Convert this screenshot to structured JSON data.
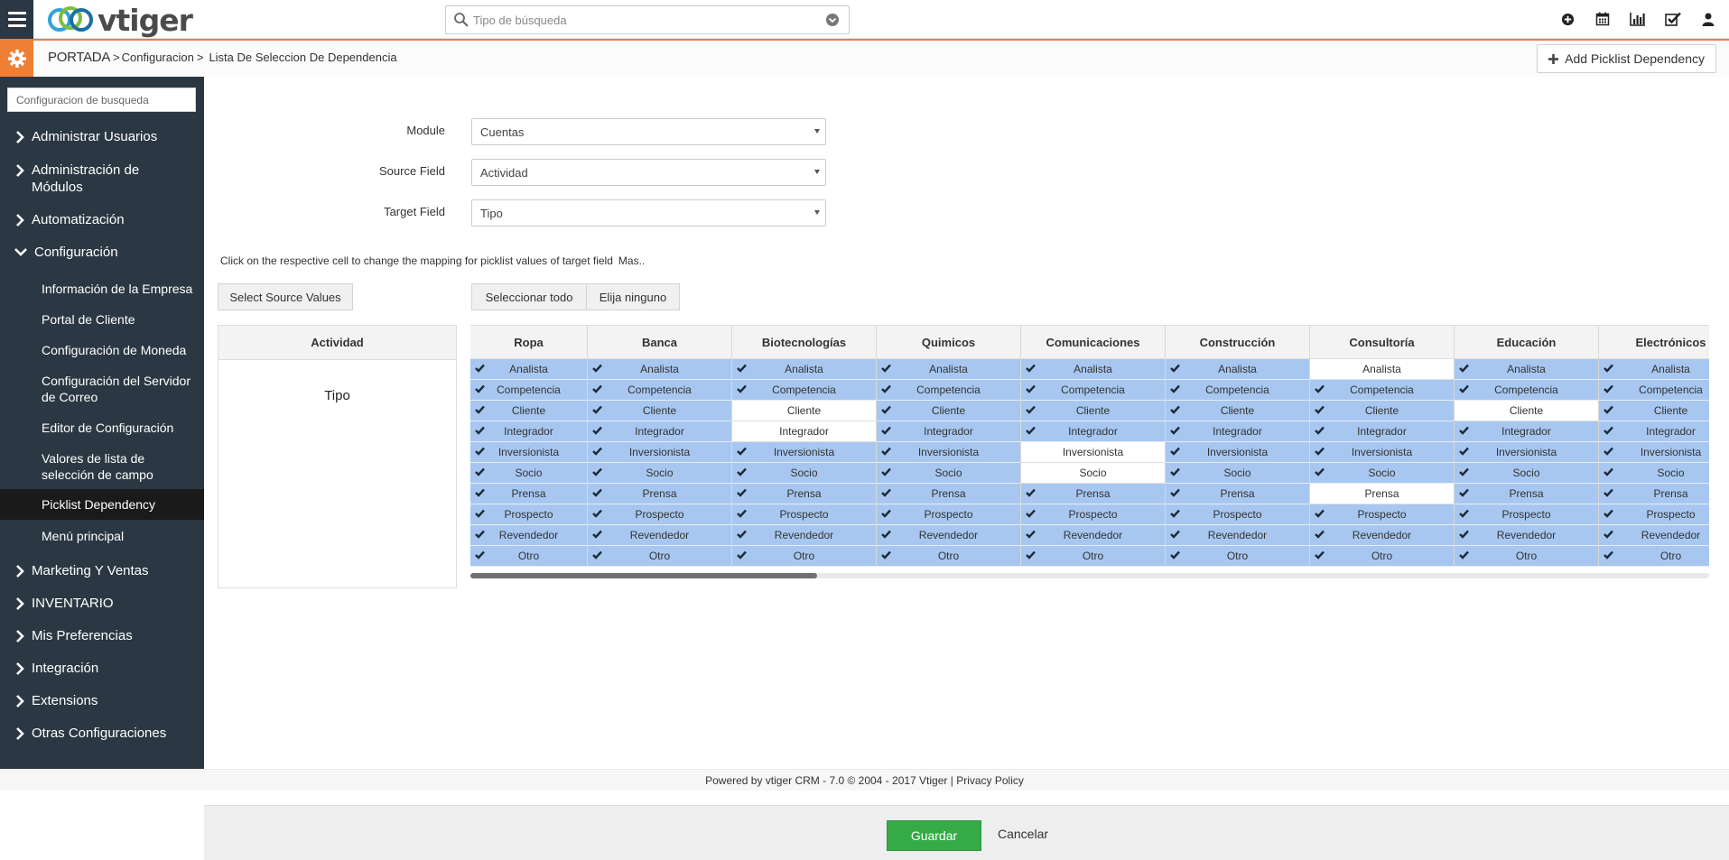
{
  "app": {
    "logo_text": "vtiger",
    "search_placeholder": "Tipo de búsqueda"
  },
  "top_icons": [
    "plus-circle-icon",
    "calendar-icon",
    "bar-chart-icon",
    "checkbox-icon",
    "user-icon"
  ],
  "breadcrumb": {
    "home": "PORTADA",
    "sep": ">",
    "section": "Configuracion",
    "page": "Lista De Seleccion De Dependencia"
  },
  "header_action": {
    "label": "Add Picklist Dependency"
  },
  "sidebar": {
    "search_placeholder": "Configuracion de busqueda",
    "items": [
      {
        "label": "Administrar Usuarios",
        "expanded": false
      },
      {
        "label": "Administración de Módulos",
        "expanded": false
      },
      {
        "label": "Automatización",
        "expanded": false
      },
      {
        "label": "Configuración",
        "expanded": true
      },
      {
        "label": "Marketing Y Ventas",
        "expanded": false
      },
      {
        "label": "INVENTARIO",
        "expanded": false
      },
      {
        "label": "Mis Preferencias",
        "expanded": false
      },
      {
        "label": "Integración",
        "expanded": false
      },
      {
        "label": "Extensions",
        "expanded": false
      },
      {
        "label": "Otras Configuraciones",
        "expanded": false
      }
    ],
    "sub_items": [
      {
        "label": "Información de la Empresa",
        "active": false
      },
      {
        "label": "Portal de Cliente",
        "active": false
      },
      {
        "label": "Configuración de Moneda",
        "active": false
      },
      {
        "label": "Configuración del Servidor de Correo",
        "active": false
      },
      {
        "label": "Editor de Configuración",
        "active": false
      },
      {
        "label": "Valores de lista de selección de campo",
        "active": false
      },
      {
        "label": "Picklist Dependency",
        "active": true
      },
      {
        "label": "Menú principal",
        "active": false
      }
    ]
  },
  "form": {
    "module_label": "Module",
    "module_value": "Cuentas",
    "source_label": "Source Field",
    "source_value": "Actividad",
    "target_label": "Target Field",
    "target_value": "Tipo"
  },
  "info": {
    "text": "Click on the respective cell to change the mapping for picklist values of target field",
    "more": "Mas.."
  },
  "buttons": {
    "select_source": "Select Source Values",
    "select_all": "Seleccionar todo",
    "select_none": "Elija ninguno"
  },
  "source_table": {
    "header": "Actividad",
    "value": "Tipo"
  },
  "matrix": {
    "target_values": [
      "Analista",
      "Competencia",
      "Cliente",
      "Integrador",
      "Inversionista",
      "Socio",
      "Prensa",
      "Prospecto",
      "Revendedor",
      "Otro"
    ],
    "columns": [
      {
        "name": "Ropa",
        "unchecked": []
      },
      {
        "name": "Banca",
        "unchecked": []
      },
      {
        "name": "Biotecnologías",
        "unchecked": [
          "Cliente",
          "Integrador"
        ]
      },
      {
        "name": "Quimicos",
        "unchecked": []
      },
      {
        "name": "Comunicaciones",
        "unchecked": [
          "Inversionista",
          "Socio"
        ]
      },
      {
        "name": "Construcción",
        "unchecked": []
      },
      {
        "name": "Consultoría",
        "unchecked": [
          "Analista",
          "Prensa"
        ]
      },
      {
        "name": "Educación",
        "unchecked": [
          "Cliente"
        ]
      },
      {
        "name": "Electrónicos",
        "unchecked": []
      }
    ],
    "scroll_fraction_visible": 0.28
  },
  "footer": {
    "powered": "Powered by vtiger CRM - 7.0  © 2004 - 2017  Vtiger |",
    "privacy": "Privacy Policy"
  },
  "actions": {
    "save": "Guardar",
    "cancel": "Cancelar"
  },
  "colors": {
    "accent": "#f07e34",
    "sidebar_bg": "#2b3843",
    "selected_cell": "#a7c7f0",
    "save_button": "#35aa47"
  }
}
